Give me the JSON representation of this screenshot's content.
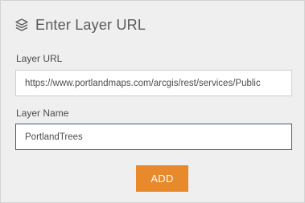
{
  "dialog": {
    "title": "Enter Layer URL",
    "icon": "layers-icon"
  },
  "layer_url": {
    "label": "Layer URL",
    "value": "https://www.portlandmaps.com/arcgis/rest/services/Public"
  },
  "layer_name": {
    "label": "Layer Name",
    "value": "PortlandTrees"
  },
  "add_button": {
    "label": "ADD",
    "color": "#e8892b"
  },
  "colors": {
    "panel_bg": "#efefef",
    "focus_border": "#34607f"
  }
}
